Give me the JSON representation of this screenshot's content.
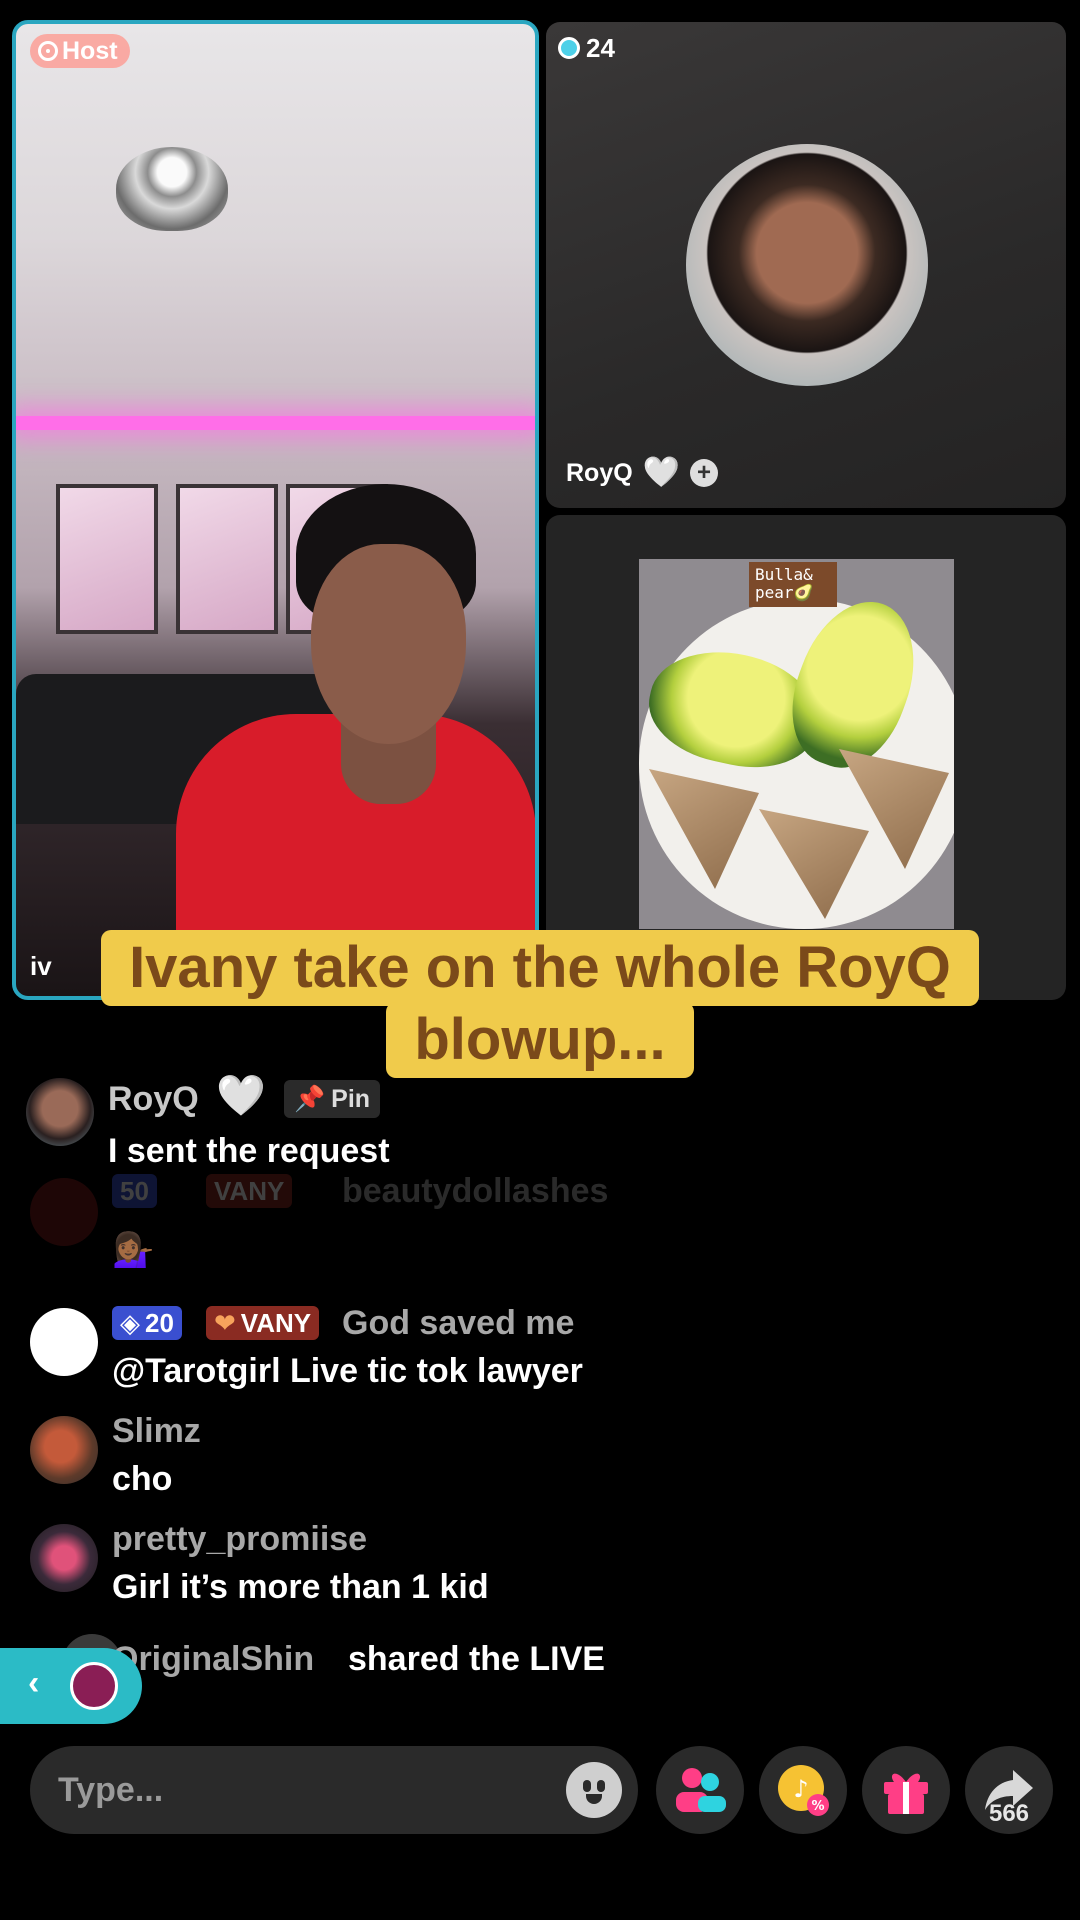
{
  "host_tile": {
    "badge_label": "Host",
    "host_name_partial": "iv"
  },
  "guest_tile": {
    "viewer_count": "24",
    "guest_name": "RoyQ",
    "heart": "❤",
    "plus": "+"
  },
  "third_tile": {
    "photo_label": "Bulla&\npear🥑"
  },
  "caption": {
    "line1": "Ivany take on the whole RoyQ",
    "line2": "blowup..."
  },
  "chat": {
    "pinned": {
      "username": "RoyQ",
      "heart": "🤍",
      "pin_label": "Pin",
      "text": "I sent the request"
    },
    "faded": {
      "level": "50",
      "fan_label": "VANY",
      "username": "beautydollashes",
      "text": "💁🏾‍♀️"
    },
    "messages": [
      {
        "level": "20",
        "fan_label": "VANY",
        "username": "God saved me",
        "text": "@Tarotgirl Live tic tok lawyer"
      },
      {
        "username": "Slimz",
        "text": "cho"
      },
      {
        "username": "pretty_promiise",
        "text": "Girl it’s more than 1 kid"
      }
    ],
    "share_event": {
      "username": "OriginalShin",
      "text": "shared the LIVE"
    }
  },
  "bottom_bar": {
    "input_placeholder": "Type...",
    "share_count": "566"
  },
  "colors": {
    "host_border": "#2aa6c0",
    "caption_bg": "#f0cb4b",
    "caption_text": "#7b4a1a",
    "level_badge": "#3a4fd0",
    "fan_badge": "#8a2b22",
    "share_widget": "#2bbbc6"
  },
  "icons": {
    "host": "host-icon",
    "viewers": "viewers-icon",
    "pin": "pin-icon",
    "emoji": "emoji-icon",
    "multi_guest": "multi-guest-icon",
    "coin_promo": "coin-promo-icon",
    "gift": "gift-icon",
    "share": "share-icon"
  }
}
